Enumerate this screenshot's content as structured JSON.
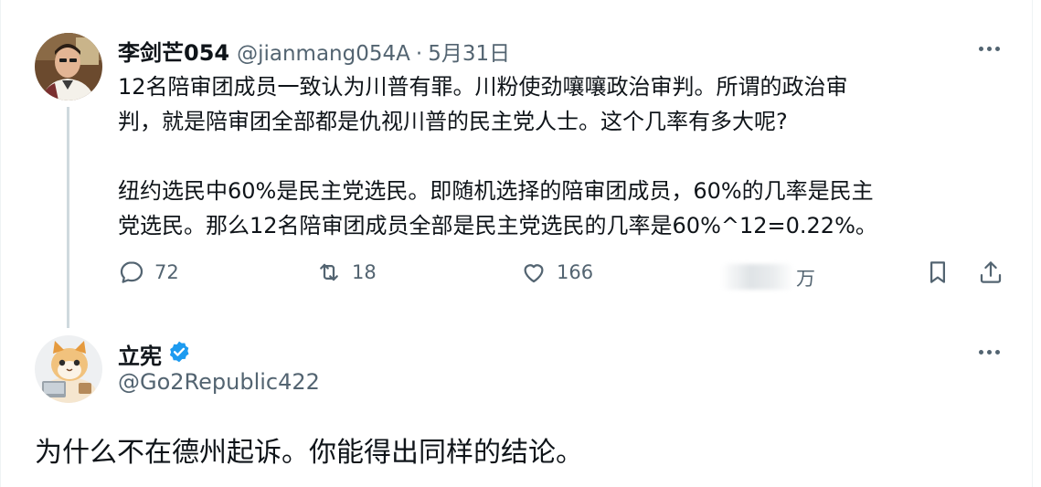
{
  "tweet1": {
    "author_name": "李剑芒054",
    "handle": "@jianmang054A",
    "separator": "·",
    "date": "5月31日",
    "paragraph1": "12名陪审团成员一致认为川普有罪。川粉使劲嚷嚷政治审判。所谓的政治审\n判，就是陪审团全部都是仇视川普的民主党人士。这个几率有多大呢?",
    "paragraph2": "纽约选民中60%是民主党选民。即随机选择的陪审团成员，60%的几率是民主\n党选民。那么12名陪审团成员全部是民主党选民的几率是60%^12=0.22%。",
    "actions": {
      "replies": "72",
      "reposts": "18",
      "likes": "166",
      "views_unit": "万"
    }
  },
  "tweet2": {
    "author_name": "立宪",
    "handle": "@Go2Republic422",
    "text": "为什么不在德州起诉。你能得出同样的结论。"
  },
  "colors": {
    "text_primary": "#0f1419",
    "text_secondary": "#536471",
    "verified_blue": "#1d9bf0",
    "thread_line": "#cfd9de"
  },
  "icons": [
    "more-icon",
    "reply-icon",
    "repost-icon",
    "like-icon",
    "bookmark-icon",
    "share-icon",
    "verified-badge-icon"
  ]
}
